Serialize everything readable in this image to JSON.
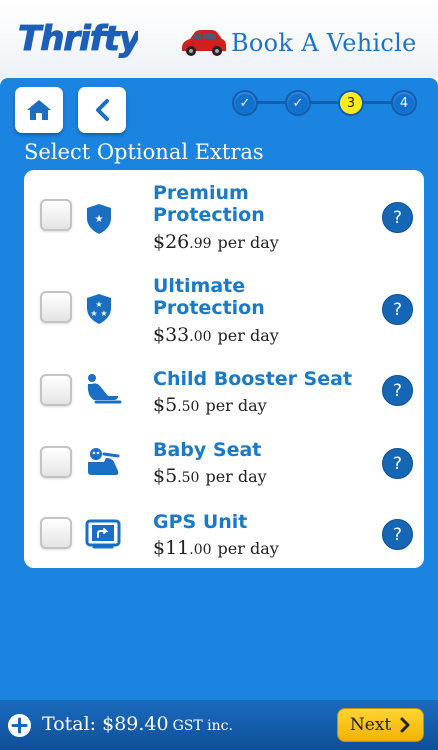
{
  "header": {
    "logo_text": "Thrifty",
    "title": "Book A Vehicle"
  },
  "nav": {
    "home_icon": "home-icon",
    "back_icon": "chevron-left-icon"
  },
  "stepper": {
    "steps": [
      {
        "label": "✓",
        "state": "done"
      },
      {
        "label": "✓",
        "state": "done"
      },
      {
        "label": "3",
        "state": "current"
      },
      {
        "label": "4",
        "state": "pending"
      }
    ]
  },
  "section_title": "Select Optional Extras",
  "extras": [
    {
      "name": "Premium Protection",
      "dollars": "$26",
      "cents": ".99",
      "per": "per day",
      "icon": "shield-star-icon",
      "checked": false
    },
    {
      "name": "Ultimate Protection",
      "dollars": "$33",
      "cents": ".00",
      "per": "per day",
      "icon": "shield-stars-icon",
      "checked": false
    },
    {
      "name": "Child Booster Seat",
      "dollars": "$5",
      "cents": ".50",
      "per": "per day",
      "icon": "booster-seat-icon",
      "checked": false
    },
    {
      "name": "Baby Seat",
      "dollars": "$5",
      "cents": ".50",
      "per": "per day",
      "icon": "baby-seat-icon",
      "checked": false
    },
    {
      "name": "GPS Unit",
      "dollars": "$11",
      "cents": ".00",
      "per": "per day",
      "icon": "gps-icon",
      "checked": false
    }
  ],
  "help_label": "?",
  "footer": {
    "total": "Total: $89.40",
    "gst": "GST inc.",
    "next_label": "Next"
  },
  "colors": {
    "brand_blue": "#1b84e0",
    "title_blue": "#1a7ac8",
    "next_yellow": "#ffcc00",
    "current_step": "#ffeb1a"
  }
}
